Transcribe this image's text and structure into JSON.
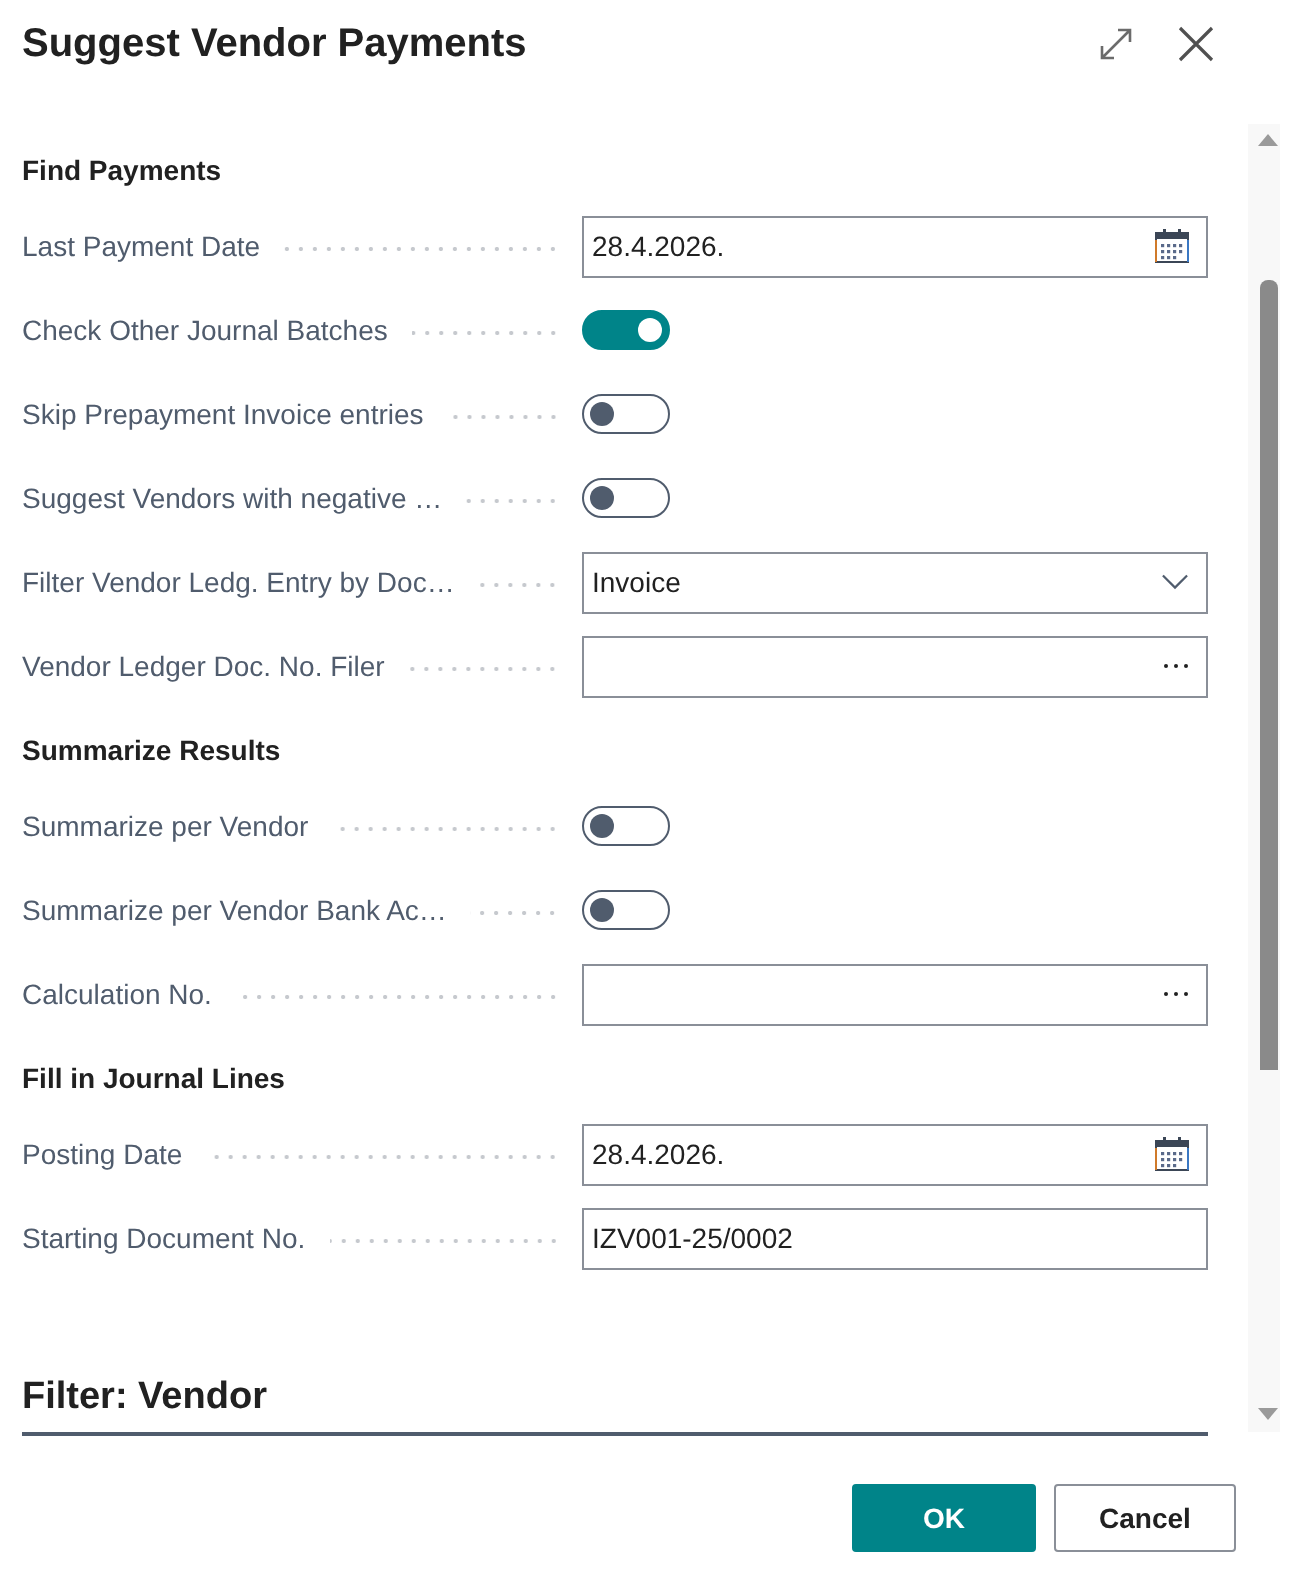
{
  "dialog": {
    "title": "Suggest Vendor Payments"
  },
  "sections": [
    {
      "heading": "Find Payments",
      "fields": [
        {
          "kind": "date",
          "label": "Last Payment Date",
          "value": "28.4.2026."
        },
        {
          "kind": "toggle",
          "label": "Check Other Journal Batches",
          "on": true
        },
        {
          "kind": "toggle",
          "label": "Skip Prepayment Invoice entries",
          "on": false
        },
        {
          "kind": "toggle",
          "label": "Suggest Vendors with negative …",
          "on": false
        },
        {
          "kind": "dropdown",
          "label": "Filter Vendor Ledg. Entry by Doc…",
          "value": "Invoice"
        },
        {
          "kind": "lookup",
          "label": "Vendor Ledger Doc. No. Filer"
        }
      ]
    },
    {
      "heading": "Summarize Results",
      "fields": [
        {
          "kind": "toggle",
          "label": "Summarize per Vendor",
          "on": false
        },
        {
          "kind": "toggle",
          "label": "Summarize per Vendor Bank Ac…",
          "on": false
        },
        {
          "kind": "lookup",
          "label": "Calculation No."
        }
      ]
    },
    {
      "heading": "Fill in Journal Lines",
      "fields": [
        {
          "kind": "date",
          "label": "Posting Date",
          "value": "28.4.2026."
        },
        {
          "kind": "text",
          "label": "Starting Document No.",
          "value": "IZV001-25/0002"
        }
      ]
    }
  ],
  "filter": {
    "heading": "Filter: Vendor"
  },
  "buttons": [
    {
      "label": "OK",
      "primary": true
    },
    {
      "label": "Cancel",
      "primary": false
    }
  ]
}
